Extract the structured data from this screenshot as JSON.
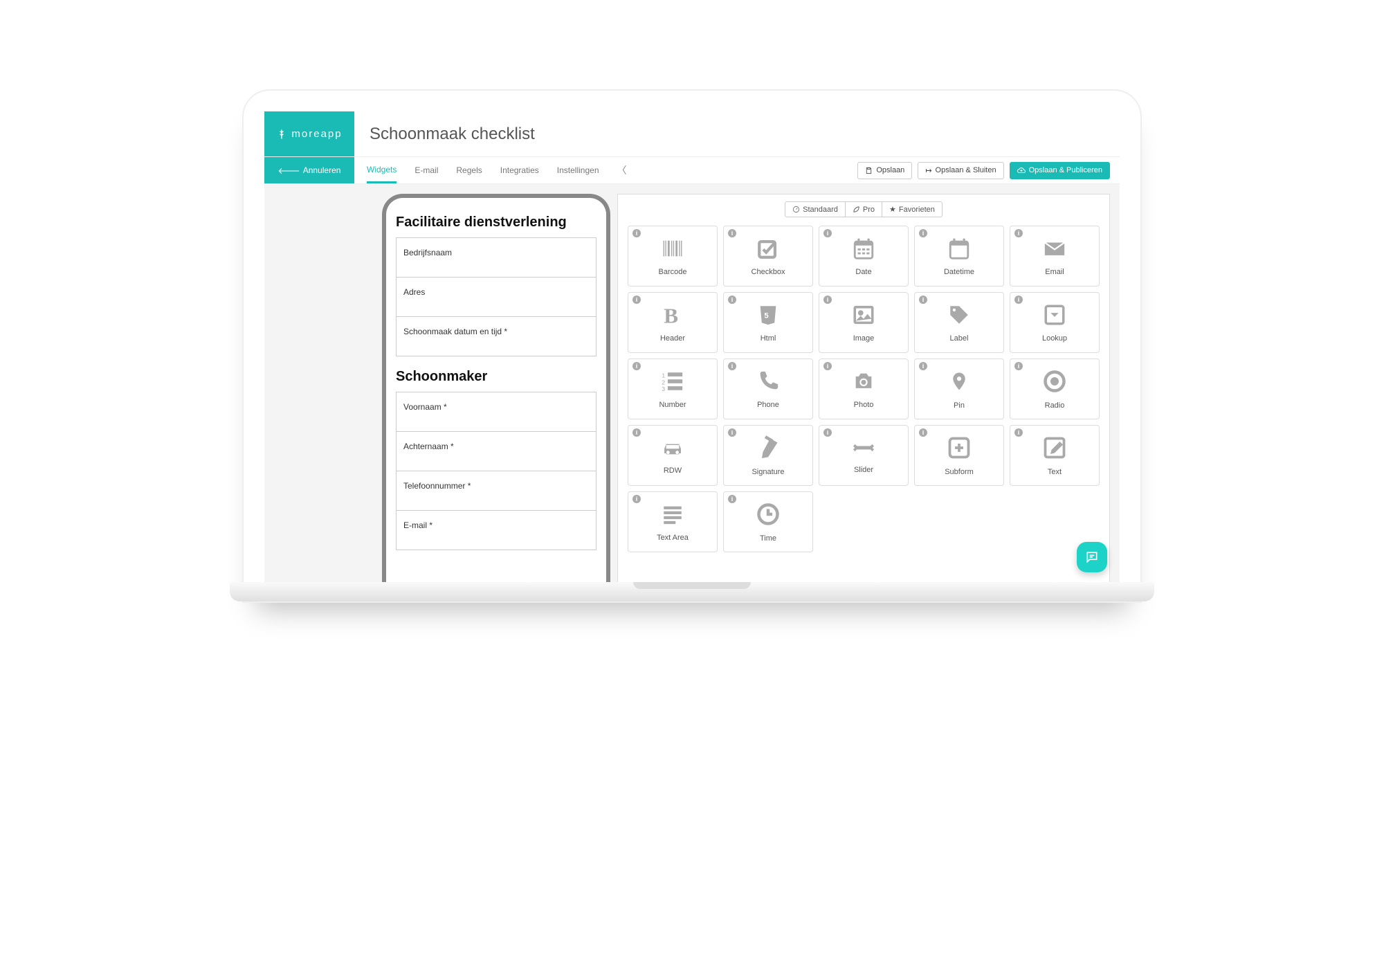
{
  "brand": "moreapp",
  "page_title": "Schoonmaak checklist",
  "cancel_label": "Annuleren",
  "nav_tabs": {
    "widgets": "Widgets",
    "email": "E-mail",
    "rules": "Regels",
    "integrations": "Integraties",
    "settings": "Instellingen"
  },
  "buttons": {
    "save": "Opslaan",
    "save_close": "Opslaan & Sluiten",
    "save_publish": "Opslaan & Publiceren"
  },
  "form_preview": {
    "section1_title": "Facilitaire dienstverlening",
    "section1_fields": [
      "Bedrijfsnaam",
      "Adres",
      "Schoonmaak datum en tijd *"
    ],
    "section2_title": "Schoonmaker",
    "section2_fields": [
      "Voornaam *",
      "Achternaam *",
      "Telefoonnummer *",
      "E-mail *"
    ]
  },
  "palette_tabs": {
    "standard": "Standaard",
    "pro": "Pro",
    "favorites": "Favorieten"
  },
  "widgets": [
    {
      "key": "barcode",
      "label": "Barcode"
    },
    {
      "key": "checkbox",
      "label": "Checkbox"
    },
    {
      "key": "date",
      "label": "Date"
    },
    {
      "key": "datetime",
      "label": "Datetime"
    },
    {
      "key": "email",
      "label": "Email"
    },
    {
      "key": "header",
      "label": "Header"
    },
    {
      "key": "html",
      "label": "Html"
    },
    {
      "key": "image",
      "label": "Image"
    },
    {
      "key": "label",
      "label": "Label"
    },
    {
      "key": "lookup",
      "label": "Lookup"
    },
    {
      "key": "number",
      "label": "Number"
    },
    {
      "key": "phone",
      "label": "Phone"
    },
    {
      "key": "photo",
      "label": "Photo"
    },
    {
      "key": "pin",
      "label": "Pin"
    },
    {
      "key": "radio",
      "label": "Radio"
    },
    {
      "key": "rdw",
      "label": "RDW"
    },
    {
      "key": "signature",
      "label": "Signature"
    },
    {
      "key": "slider",
      "label": "Slider"
    },
    {
      "key": "subform",
      "label": "Subform"
    },
    {
      "key": "text",
      "label": "Text"
    },
    {
      "key": "textarea",
      "label": "Text Area"
    },
    {
      "key": "time",
      "label": "Time"
    }
  ]
}
